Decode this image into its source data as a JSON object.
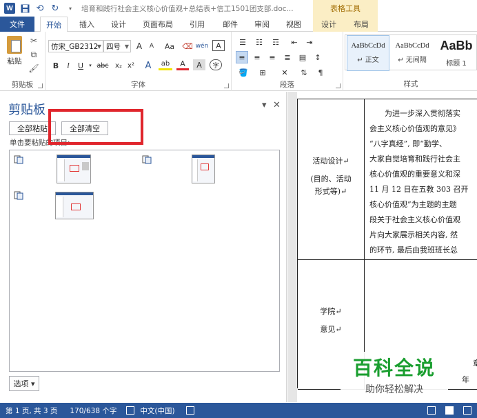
{
  "titlebar": {
    "logo": "W",
    "undo_icon": "undo-arrow",
    "redo_icon": "redo-arrow",
    "save_icon": "floppy-disk",
    "doc_title": "培育和践行社会主义核心价值观+总结表+信工1501团支部.doc...",
    "table_tools": "表格工具"
  },
  "tabs": [
    {
      "label": "文件"
    },
    {
      "label": "开始"
    },
    {
      "label": "插入"
    },
    {
      "label": "设计"
    },
    {
      "label": "页面布局"
    },
    {
      "label": "引用"
    },
    {
      "label": "邮件"
    },
    {
      "label": "审阅"
    },
    {
      "label": "视图"
    },
    {
      "label": "设计"
    },
    {
      "label": "布局"
    }
  ],
  "ribbon": {
    "clipboard": {
      "paste_label": "粘贴",
      "group_label": "剪贴板"
    },
    "font": {
      "font_name": "仿宋_GB2312",
      "font_size": "四号",
      "grow": "A",
      "shrink": "A",
      "case": "Aa",
      "clear": "🧹",
      "phonetic": "wén",
      "border_char": "A",
      "bold": "B",
      "italic": "I",
      "underline": "U",
      "strike": "abc",
      "subscript": "x₂",
      "superscript": "x²",
      "effects": "A",
      "highlight": "ab",
      "color": "A",
      "shading": "A",
      "enclose": "字",
      "group_label": "字体"
    },
    "paragraph": {
      "group_label": "段落"
    },
    "styles": {
      "items": [
        {
          "sample": "AaBbCcDd",
          "name": "↵ 正文"
        },
        {
          "sample": "AaBbCcDd",
          "name": "↵ 无间隔"
        },
        {
          "sample": "AaBb",
          "name": "标题 1"
        }
      ],
      "group_label": "样式"
    }
  },
  "clipboard_pane": {
    "title": "剪贴板",
    "dropdown": "▾",
    "close": "✕",
    "paste_all": "全部粘贴",
    "clear_all": "全部清空",
    "hint": "单击要粘贴的项目:",
    "options": "选项 ▾"
  },
  "document": {
    "label_design": "活动设计↵",
    "label_design_sub": "(目的、活动",
    "label_design_sub2": "形式等)↵",
    "lines": [
      "　　为进一步深入贯彻落实",
      "会主义核心价值观的意见》",
      "“八字真经”, 即“勤学、",
      "大家自觉培育和践行社会主",
      "核心价值观的重要意义和深",
      "11 月 12 日在五教 303 召开",
      "核心价值观”为主题的主题",
      "段关于社会主义核心价值观",
      "片向大家展示相关内容, 然",
      "的环节, 最后由我班班长总"
    ],
    "label_college": "学院↵",
    "label_opinion": "意见↵",
    "bottom_year": "年",
    "bottom_char": "章"
  },
  "watermark": {
    "main": "百科全说",
    "sub": "助你轻松解决"
  },
  "statusbar": {
    "pages": "第 1 页, 共 3 页",
    "words": "170/638 个字",
    "language": "中文(中国)"
  },
  "colors": {
    "accent": "#2b579a",
    "table_tools": "#fbeec5",
    "highlight_box": "#e0262d",
    "watermark_green": "#1a9e2f"
  }
}
